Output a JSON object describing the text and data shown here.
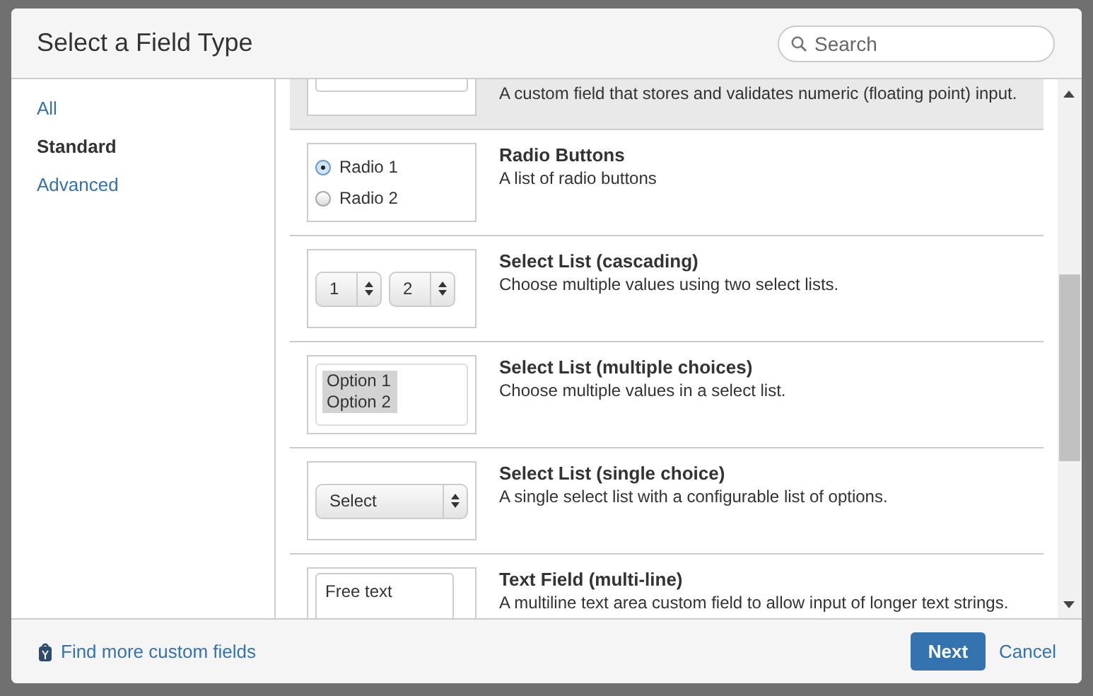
{
  "dialog": {
    "title": "Select a Field Type"
  },
  "search": {
    "placeholder": "Search"
  },
  "sidebar": {
    "items": [
      {
        "label": "All",
        "selected": false
      },
      {
        "label": "Standard",
        "selected": true
      },
      {
        "label": "Advanced",
        "selected": false
      }
    ]
  },
  "field_types": [
    {
      "kind": "number",
      "description": "A custom field that stores and validates numeric (floating point) input.",
      "selected": true
    },
    {
      "kind": "radio",
      "title": "Radio Buttons",
      "description": "A list of radio buttons",
      "preview": [
        {
          "label": "Radio 1",
          "checked": true
        },
        {
          "label": "Radio 2",
          "checked": false
        }
      ],
      "selected": false
    },
    {
      "kind": "cascading",
      "title": "Select List (cascading)",
      "description": "Choose multiple values using two select lists.",
      "preview": [
        {
          "label": "1"
        },
        {
          "label": "2"
        }
      ],
      "selected": false
    },
    {
      "kind": "multi",
      "title": "Select List (multiple choices)",
      "description": "Choose multiple values in a select list.",
      "preview": [
        {
          "label": "Option 1"
        },
        {
          "label": "Option 2"
        }
      ],
      "selected": false
    },
    {
      "kind": "single",
      "title": "Select List (single choice)",
      "description": "A single select list with a configurable list of options.",
      "preview": [
        {
          "label": "Select"
        }
      ],
      "selected": false
    },
    {
      "kind": "textarea",
      "title": "Text Field (multi-line)",
      "description": "A multiline text area custom field to allow input of longer text strings.",
      "preview": [
        {
          "label": "Free text"
        }
      ],
      "selected": false
    }
  ],
  "footer": {
    "link": "Find more custom fields",
    "primary_button": "Next",
    "cancel_link": "Cancel"
  }
}
